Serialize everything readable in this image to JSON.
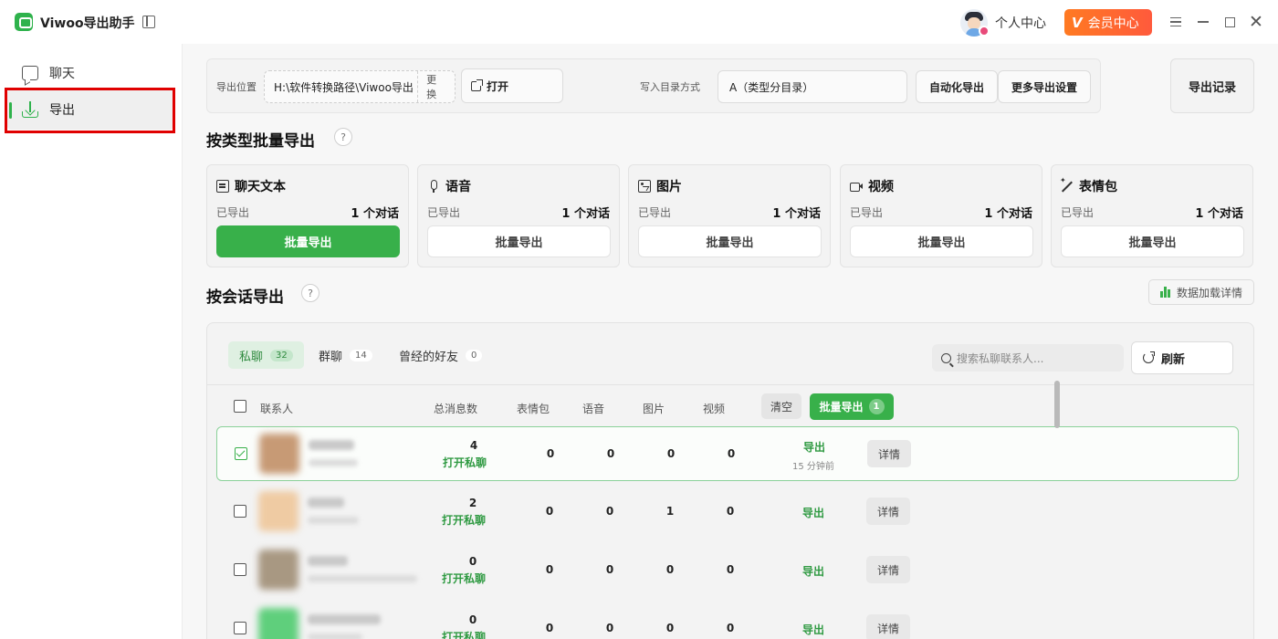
{
  "app": {
    "title": "Viwoo导出助手"
  },
  "header": {
    "personal_center": "个人中心",
    "vip_label": "会员中心",
    "vip_mark": "V"
  },
  "sidebar": {
    "items": [
      {
        "label": "聊天",
        "icon": "chat-icon"
      },
      {
        "label": "导出",
        "icon": "download-icon",
        "active": true
      }
    ]
  },
  "settings": {
    "path_label": "导出位置",
    "path_value": "H:\\软件转换路径\\Viwoo导出",
    "change_label": "更换",
    "open_label": "打开",
    "dir_mode_label": "写入目录方式",
    "dir_mode_value": "A（类型分目录）",
    "auto_export_label": "自动化导出",
    "more_settings_label": "更多导出设置",
    "records_label": "导出记录"
  },
  "batch_by_type": {
    "title": "按类型批量导出",
    "help": "?",
    "cards": [
      {
        "title": "聊天文本",
        "icon": "document-icon",
        "done_label": "已导出",
        "count": "1 个对话",
        "button": "批量导出",
        "primary": true
      },
      {
        "title": "语音",
        "icon": "microphone-icon",
        "done_label": "已导出",
        "count": "1 个对话",
        "button": "批量导出"
      },
      {
        "title": "图片",
        "icon": "image-icon",
        "done_label": "已导出",
        "count": "1 个对话",
        "button": "批量导出"
      },
      {
        "title": "视频",
        "icon": "video-icon",
        "done_label": "已导出",
        "count": "1 个对话",
        "button": "批量导出"
      },
      {
        "title": "表情包",
        "icon": "sticker-wand-icon",
        "done_label": "已导出",
        "count": "1 个对话",
        "button": "批量导出"
      }
    ]
  },
  "by_session": {
    "title": "按会话导出",
    "help": "?",
    "load_details_label": "数据加载详情",
    "tabs": [
      {
        "label": "私聊",
        "count": "32",
        "active": true
      },
      {
        "label": "群聊",
        "count": "14"
      },
      {
        "label": "曾经的好友",
        "count": "0"
      }
    ],
    "search_placeholder": "搜索私聊联系人...",
    "refresh_label": "刷新",
    "columns": {
      "contact": "联系人",
      "total": "总消息数",
      "stickers": "表情包",
      "voice": "语音",
      "images": "图片",
      "video": "视频"
    },
    "clear_label": "清空",
    "batch_export_label": "批量导出",
    "batch_export_count": "1",
    "rows": [
      {
        "selected": true,
        "total": "4",
        "open_label": "打开私聊",
        "stickers": "0",
        "voice": "0",
        "images": "0",
        "video": "0",
        "export_label": "导出",
        "ago": "15 分钟前",
        "detail_label": "详情"
      },
      {
        "selected": false,
        "total": "2",
        "open_label": "打开私聊",
        "stickers": "0",
        "voice": "0",
        "images": "1",
        "video": "0",
        "export_label": "导出",
        "detail_label": "详情"
      },
      {
        "selected": false,
        "total": "0",
        "open_label": "打开私聊",
        "stickers": "0",
        "voice": "0",
        "images": "0",
        "video": "0",
        "export_label": "导出",
        "detail_label": "详情"
      },
      {
        "selected": false,
        "total": "0",
        "open_label": "打开私聊",
        "stickers": "0",
        "voice": "0",
        "images": "0",
        "video": "0",
        "export_label": "导出",
        "detail_label": "详情"
      }
    ]
  },
  "colors": {
    "accent": "#38b04a",
    "vip": "#ff6a30",
    "highlight": "#e00000"
  }
}
